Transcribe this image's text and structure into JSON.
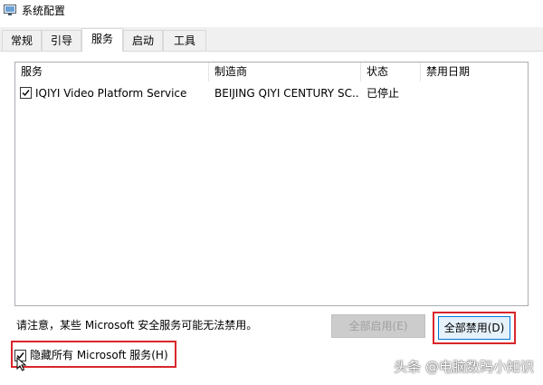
{
  "window": {
    "title": "系统配置"
  },
  "tabs": [
    {
      "label": "常规",
      "active": false
    },
    {
      "label": "引导",
      "active": false
    },
    {
      "label": "服务",
      "active": true
    },
    {
      "label": "启动",
      "active": false
    },
    {
      "label": "工具",
      "active": false
    }
  ],
  "services": {
    "columns": [
      "服务",
      "制造商",
      "状态",
      "禁用日期"
    ],
    "rows": [
      {
        "checked": true,
        "service": "IQIYI Video Platform Service",
        "manufacturer": "BEIJING QIYI CENTURY SC...",
        "status": "已停止",
        "disabled_date": ""
      }
    ]
  },
  "footer": {
    "notice": "请注意，某些 Microsoft 安全服务可能无法禁用。",
    "enable_all": "全部启用(E)",
    "disable_all": "全部禁用(D)",
    "hide_microsoft": "隐藏所有 Microsoft 服务(H)",
    "hide_microsoft_checked": true
  },
  "watermark": "头条 @电脑数码小知识",
  "colors": {
    "highlight": "#d9262b",
    "focus_border": "#0078d7"
  }
}
